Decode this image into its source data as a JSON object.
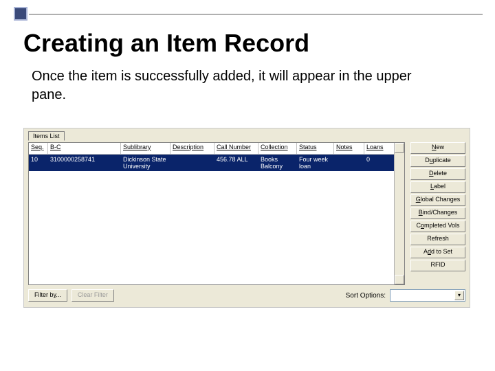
{
  "title": "Creating an Item Record",
  "body": "Once the item is successfully added, it will appear in the upper pane.",
  "colors": {
    "selected_row": "#0a246a"
  },
  "app": {
    "tab_label": "Items List",
    "columns": {
      "seq": "Seq.",
      "bc": "B-C",
      "sublibrary": "Sublibrary",
      "description": "Description",
      "callnumber": "Call Number",
      "collection": "Collection",
      "status": "Status",
      "notes": "Notes",
      "loans": "Loans"
    },
    "row": {
      "seq": "10",
      "bc": "3100000258741",
      "sublibrary": "Dickinson State University",
      "description": "",
      "callnumber": "456.78 ALL",
      "collection": "Books Balcony",
      "status": "Four week loan",
      "notes": "",
      "loans": "0"
    },
    "side_buttons": {
      "new": "New",
      "duplicate": "Duplicate",
      "delete": "Delete",
      "label": "Label",
      "global_changes": "Global Changes",
      "bind_changes": "Bind/Changes",
      "completed_vols": "Completed Vols",
      "refresh": "Refresh",
      "add_to_set": "Add to Set",
      "rfid": "RFID"
    },
    "bottom": {
      "filter_by": "Filter by...",
      "clear_filter": "Clear Filter",
      "sort_label": "Sort Options:",
      "sort_value": ""
    }
  }
}
